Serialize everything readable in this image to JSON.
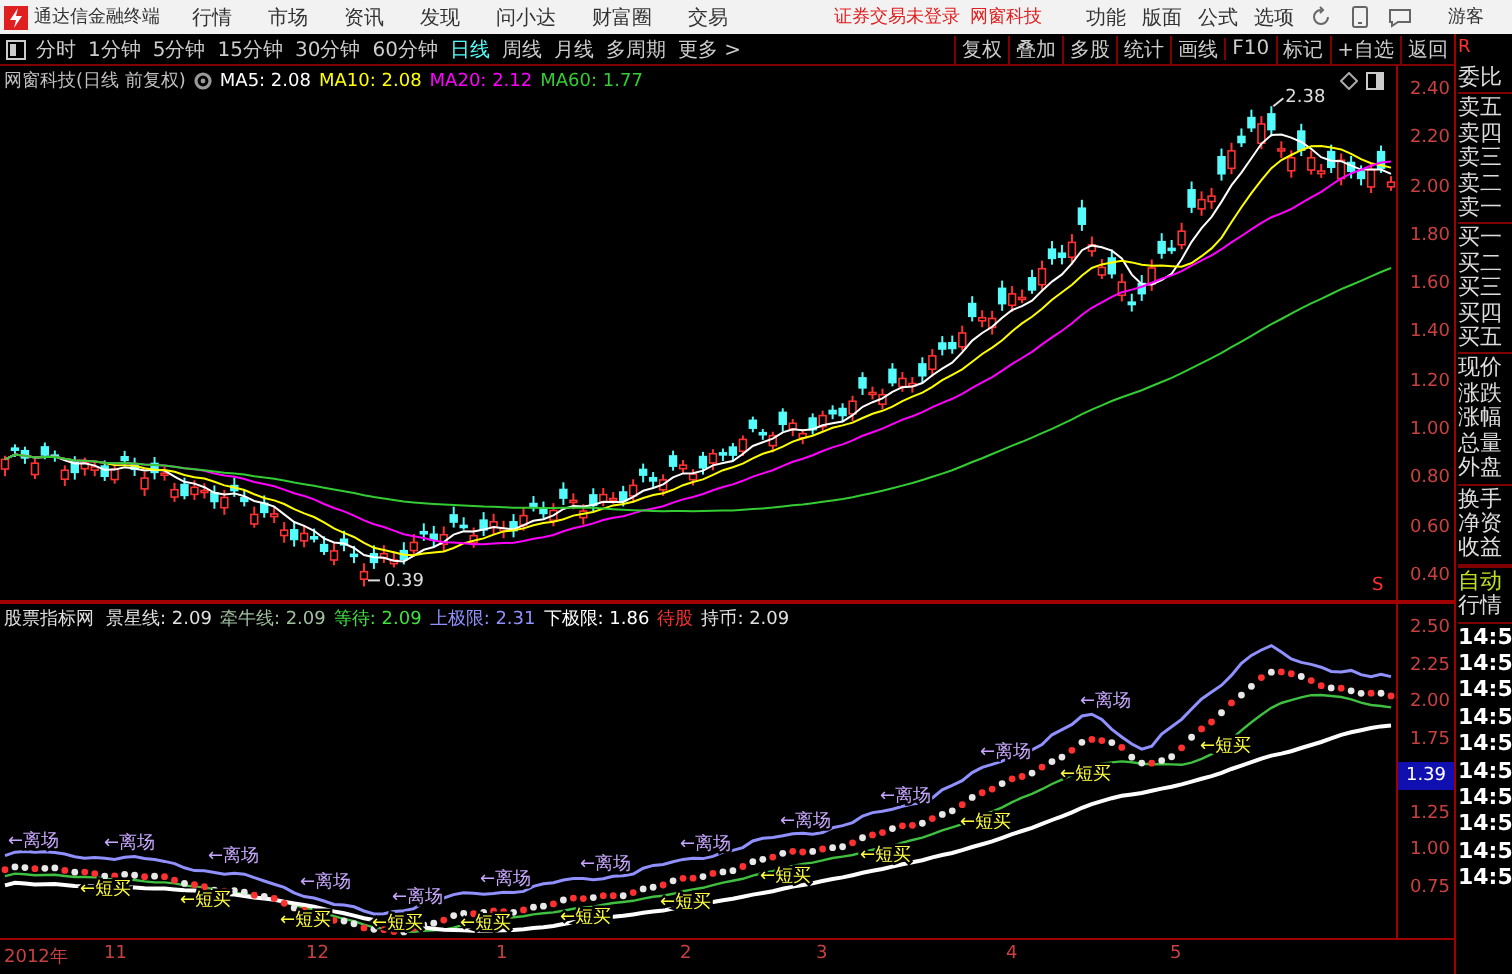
{
  "menubar": {
    "app_title": "通达信金融终端",
    "menus": [
      "行情",
      "市场",
      "资讯",
      "发现",
      "问小达",
      "财富圈",
      "交易"
    ],
    "notice": "证券交易未登录",
    "broker": "网窗科技",
    "tools": [
      "功能",
      "版面",
      "公式",
      "选项"
    ],
    "user": "游客"
  },
  "toolbar": {
    "periods": [
      {
        "label": "分时",
        "selected": false
      },
      {
        "label": "1分钟",
        "selected": false
      },
      {
        "label": "5分钟",
        "selected": false
      },
      {
        "label": "15分钟",
        "selected": false
      },
      {
        "label": "30分钟",
        "selected": false
      },
      {
        "label": "60分钟",
        "selected": false
      },
      {
        "label": "日线",
        "selected": true
      },
      {
        "label": "周线",
        "selected": false
      },
      {
        "label": "月线",
        "selected": false
      },
      {
        "label": "多周期",
        "selected": false
      },
      {
        "label": "更多 >",
        "selected": false
      }
    ],
    "actions": [
      "复权",
      "叠加",
      "多股",
      "统计",
      "画线",
      "F10",
      "标记",
      "+自选",
      "返回"
    ],
    "badge": "R"
  },
  "main_chart": {
    "title": "网窗科技(日线 前复权)",
    "ma": [
      {
        "label": "MA5: 2.08",
        "color": "#ffffff"
      },
      {
        "label": "MA10: 2.08",
        "color": "#ffff00"
      },
      {
        "label": "MA20: 2.12",
        "color": "#ff00ff"
      },
      {
        "label": "MA60: 1.77",
        "color": "#33cc33"
      }
    ],
    "high_label": "2.38",
    "low_label": "0.39",
    "marker": "S",
    "price_axis": [
      "2.40",
      "2.20",
      "2.00",
      "1.80",
      "1.60",
      "1.40",
      "1.20",
      "1.00",
      "0.80",
      "0.60",
      "0.40"
    ]
  },
  "indicator": {
    "title": "股票指标网",
    "values": [
      {
        "label": "景星线: 2.09",
        "color": "#e0e0e0"
      },
      {
        "label": "牵牛线: 2.09",
        "color": "#a0c0a0"
      },
      {
        "label": "等待: 2.09",
        "color": "#40e040"
      },
      {
        "label": "上极限: 2.31",
        "color": "#9090ff"
      },
      {
        "label": "下极限: 1.86",
        "color": "#ffffff"
      },
      {
        "label": "待股",
        "color": "#ff3030"
      },
      {
        "label": "持币: 2.09",
        "color": "#e0e0e0"
      }
    ],
    "axis_upper": [
      "2.50",
      "2.25",
      "2.00",
      "1.75"
    ],
    "current": "1.39",
    "axis_lower": [
      "1.25",
      "1.00",
      "0.75"
    ],
    "signals": [
      {
        "kind": "exit",
        "text": "←离场"
      },
      {
        "kind": "buy",
        "text": "←短买"
      },
      {
        "kind": "exit",
        "text": "←离场"
      },
      {
        "kind": "buy",
        "text": "←短买"
      },
      {
        "kind": "exit",
        "text": "←离场"
      },
      {
        "kind": "buy",
        "text": "←短买"
      },
      {
        "kind": "exit",
        "text": "←离场"
      },
      {
        "kind": "buy",
        "text": "←短买"
      },
      {
        "kind": "exit",
        "text": "←离场"
      },
      {
        "kind": "buy",
        "text": "←短买"
      },
      {
        "kind": "exit",
        "text": "←离场"
      },
      {
        "kind": "buy",
        "text": "←短买"
      },
      {
        "kind": "exit",
        "text": "←离场"
      },
      {
        "kind": "buy",
        "text": "←短买"
      },
      {
        "kind": "exit",
        "text": "←离场"
      },
      {
        "kind": "buy",
        "text": "←短买"
      },
      {
        "kind": "exit",
        "text": "←离场"
      },
      {
        "kind": "buy",
        "text": "←短买"
      },
      {
        "kind": "exit",
        "text": "←离场"
      },
      {
        "kind": "buy",
        "text": "←短买"
      },
      {
        "kind": "exit",
        "text": "←离场"
      },
      {
        "kind": "buy",
        "text": "←短买"
      },
      {
        "kind": "exit",
        "text": "←离场"
      },
      {
        "kind": "buy",
        "text": "←短买"
      }
    ]
  },
  "date_axis": [
    "2012年",
    "11",
    "12",
    "1",
    "2",
    "3",
    "4",
    "5"
  ],
  "quote_panel": {
    "groups": [
      [
        "委比"
      ],
      [
        "卖五",
        "卖四",
        "卖三",
        "卖二",
        "卖一"
      ],
      [
        "买一",
        "买二",
        "买三",
        "买四",
        "买五"
      ],
      [
        "现价",
        "涨跌",
        "涨幅",
        "总量",
        "外盘"
      ],
      [
        "换手",
        "净资",
        "收益"
      ]
    ],
    "mode": [
      "自动",
      "行情"
    ],
    "times": [
      "14:5",
      "14:5",
      "14:5",
      "14:5",
      "14:5",
      "14:5",
      "14:5",
      "14:5",
      "14:5",
      "14:5"
    ]
  }
}
